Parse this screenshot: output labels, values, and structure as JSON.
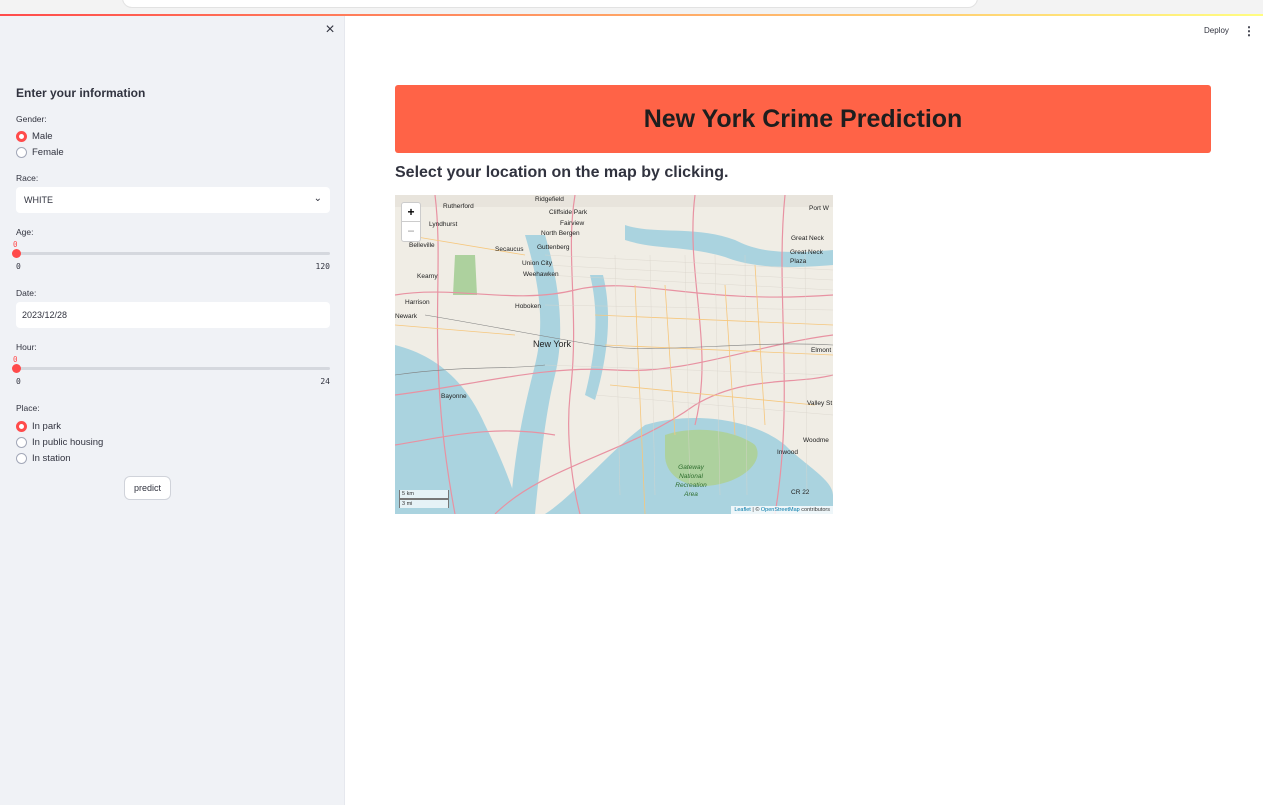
{
  "sidebar": {
    "heading": "Enter your information",
    "gender": {
      "label": "Gender:",
      "options": [
        "Male",
        "Female"
      ],
      "selected": "Male"
    },
    "race": {
      "label": "Race:",
      "value": "WHITE"
    },
    "age": {
      "label": "Age:",
      "value": "0",
      "min": "0",
      "max": "120",
      "fraction": 0
    },
    "date": {
      "label": "Date:",
      "value": "2023/12/28"
    },
    "hour": {
      "label": "Hour:",
      "value": "0",
      "min": "0",
      "max": "24",
      "fraction": 0
    },
    "place": {
      "label": "Place:",
      "options": [
        "In park",
        "In public housing",
        "In station"
      ],
      "selected": "In park"
    },
    "predict_label": "predict",
    "close_glyph": "×"
  },
  "header": {
    "deploy_label": "Deploy",
    "menu_glyph": "⋮"
  },
  "main": {
    "title": "New York Crime Prediction",
    "subtitle": "Select your location on the map by clicking."
  },
  "map": {
    "zoom_in": "+",
    "zoom_out": "−",
    "scale_km": "5 km",
    "scale_mi": "3 mi",
    "attribution_leaflet": "Leaflet",
    "attribution_sep": " | © ",
    "attribution_osm": "OpenStreetMap",
    "attribution_tail": " contributors",
    "labels": [
      "Rutherford",
      "Cliffside Park",
      "Fairview",
      "North Bergen",
      "Lyndhurst",
      "Secaucus",
      "Guttenberg",
      "Union City",
      "Weehawken",
      "Belleville",
      "Kearny",
      "Harrison",
      "Hoboken",
      "New York",
      "Bayonne",
      "Port W",
      "Great Neck",
      "Great Neck Plaza",
      "Elmont",
      "Valley St",
      "Inwood",
      "Woodme",
      "Gateway National Recreation Area",
      "CR 22",
      "Newark",
      "Ridgefield"
    ]
  },
  "colors": {
    "accent": "#ff4b4b",
    "banner": "#ff6347",
    "sidebar_bg": "#f0f2f6"
  }
}
